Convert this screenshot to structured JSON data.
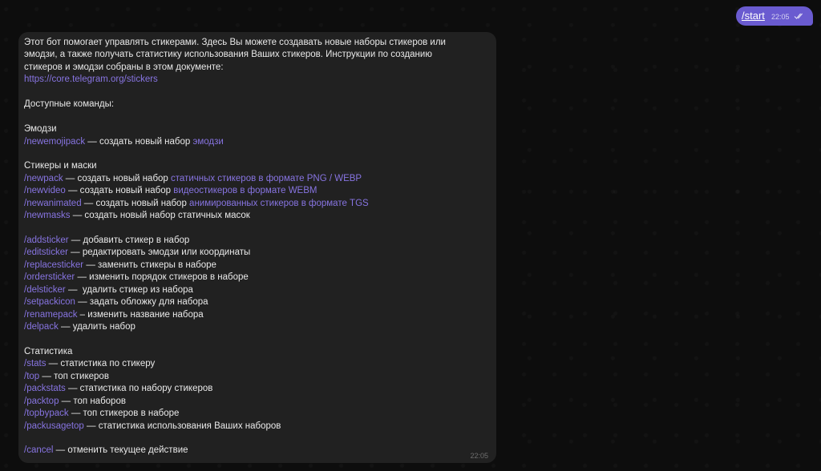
{
  "outgoing": {
    "text": "/start",
    "time": "22:05"
  },
  "incoming": {
    "intro_1": "Этот бот помогает управлять стикерами. Здесь Вы можете создавать новые наборы стикеров или",
    "intro_2": "эмодзи, а также получать статистику использования Ваших стикеров. Инструкции по созданию",
    "intro_3": "стикеров и эмодзи собраны в этом документе:",
    "doc_link": "https://core.telegram.org/stickers",
    "available": "Доступные команды:",
    "emoji_header": "Эмодзи",
    "newemojipack_cmd": "/newemojipack",
    "newemojipack_desc": " — создать новый набор ",
    "newemojipack_link": "эмодзи",
    "stickers_header": "Стикеры и маски",
    "newpack_cmd": "/newpack",
    "newpack_desc": " — создать новый набор ",
    "newpack_link": "статичных стикеров в формате PNG / WEBP",
    "newvideo_cmd": "/newvideo",
    "newvideo_desc": " — создать новый набор ",
    "newvideo_link": "видеостикеров в формате WEBM",
    "newanimated_cmd": "/newanimated",
    "newanimated_desc": " — создать новый набор ",
    "newanimated_link": "анимированных стикеров в формате TGS",
    "newmasks_cmd": "/newmasks",
    "newmasks_desc": " — создать новый набор статичных масок",
    "edit_commands": [
      {
        "cmd": "/addsticker",
        "desc": " — добавить стикер в набор"
      },
      {
        "cmd": "/editsticker",
        "desc": " — редактировать эмодзи или координаты"
      },
      {
        "cmd": "/replacesticker",
        "desc": " — заменить стикеры в наборе"
      },
      {
        "cmd": "/ordersticker",
        "desc": " — изменить порядок стикеров в наборе"
      },
      {
        "cmd": "/delsticker",
        "desc": " —  удалить стикер из набора"
      },
      {
        "cmd": "/setpackicon",
        "desc": " — задать обложку для набора"
      },
      {
        "cmd": "/renamepack",
        "desc": " – изменить название набора"
      },
      {
        "cmd": "/delpack",
        "desc": " — удалить набор"
      }
    ],
    "stats_header": "Статистика",
    "stats_commands": [
      {
        "cmd": "/stats",
        "desc": " — статистика по стикеру"
      },
      {
        "cmd": "/top",
        "desc": " — топ стикеров"
      },
      {
        "cmd": "/packstats",
        "desc": " — статистика по набору стикеров"
      },
      {
        "cmd": "/packtop",
        "desc": " — топ наборов"
      },
      {
        "cmd": "/topbypack",
        "desc": " — топ стикеров в наборе"
      },
      {
        "cmd": "/packusagetop",
        "desc": " — статистика использования Ваших наборов"
      }
    ],
    "cancel_cmd": "/cancel",
    "cancel_desc": " — отменить текущее действие",
    "time": "22:05"
  },
  "colors": {
    "link": "#8774e1",
    "outgoing_bubble": "#6a5bd0",
    "incoming_bubble": "#212121"
  }
}
